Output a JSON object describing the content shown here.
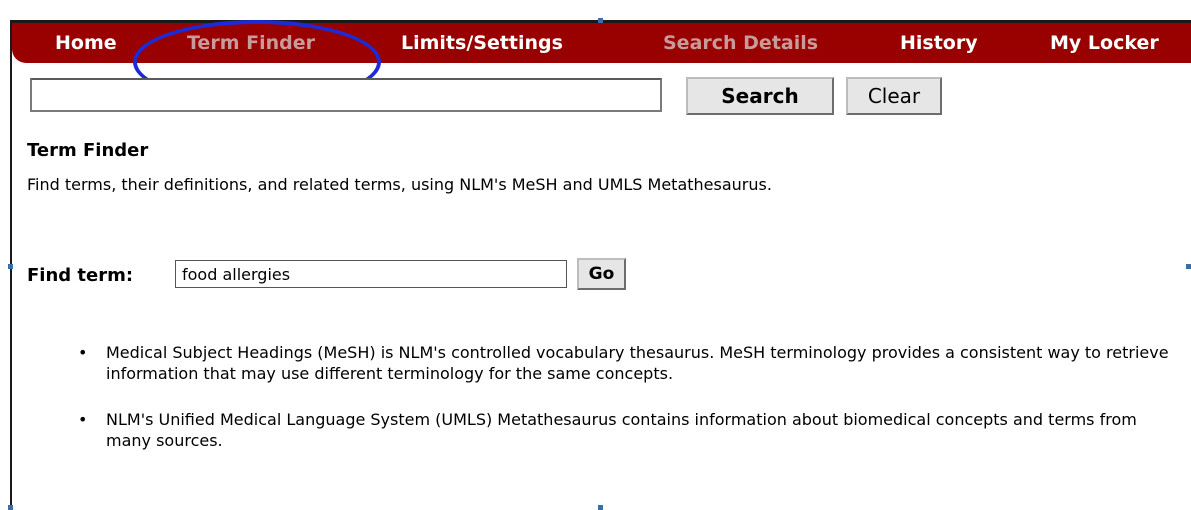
{
  "nav": {
    "items": [
      {
        "label": "Home"
      },
      {
        "label": "Term Finder"
      },
      {
        "label": "Limits/Settings"
      },
      {
        "label": "Search Details"
      },
      {
        "label": "History"
      },
      {
        "label": "My Locker"
      }
    ],
    "active": "Term Finder",
    "bar_color": "#990000",
    "highlight_color": "#1d2ad6"
  },
  "search": {
    "value": "",
    "search_label": "Search",
    "clear_label": "Clear"
  },
  "term_finder": {
    "title": "Term Finder",
    "description": "Find terms, their definitions, and related terms, using NLM's MeSH and UMLS Metathesaurus.",
    "find_label": "Find term:",
    "find_value": "food allergies",
    "go_label": "Go"
  },
  "info": {
    "bullets": [
      "Medical Subject Headings (MeSH) is NLM's controlled vocabulary thesaurus. MeSH terminology provides a consistent way to retrieve information that may use different terminology for the same concepts.",
      "NLM's Unified Medical Language System (UMLS) Metathesaurus contains information about biomedical concepts and terms from many sources."
    ]
  }
}
